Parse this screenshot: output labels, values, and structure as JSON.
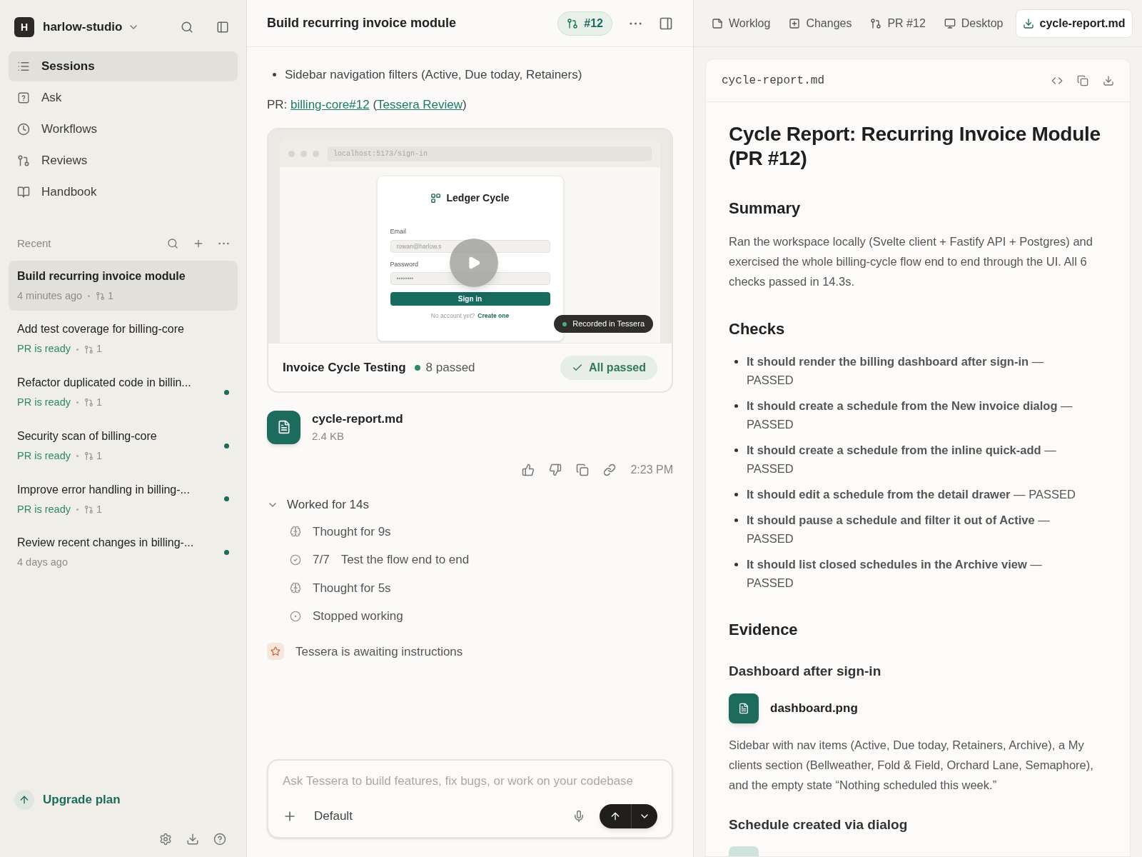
{
  "workspace": {
    "avatar": "H",
    "name": "harlow-studio"
  },
  "nav": [
    {
      "label": "Sessions",
      "selected": true
    },
    {
      "label": "Ask",
      "selected": false
    },
    {
      "label": "Workflows",
      "selected": false
    },
    {
      "label": "Reviews",
      "selected": false
    },
    {
      "label": "Handbook",
      "selected": false
    }
  ],
  "recent": {
    "title": "Recent",
    "sessions": [
      {
        "title": "Build recurring invoice module",
        "meta": "4 minutes ago",
        "kind": "time",
        "pr_count": "1",
        "unread": false,
        "selected": true
      },
      {
        "title": "Add test coverage for billing-core",
        "meta": "PR is ready",
        "kind": "ready",
        "pr_count": "1",
        "unread": false,
        "selected": false
      },
      {
        "title": "Refactor duplicated code in billin...",
        "meta": "PR is ready",
        "kind": "ready",
        "pr_count": "1",
        "unread": true,
        "selected": false
      },
      {
        "title": "Security scan of billing-core",
        "meta": "PR is ready",
        "kind": "ready",
        "pr_count": "1",
        "unread": true,
        "selected": false
      },
      {
        "title": "Improve error handling in billing-...",
        "meta": "PR is ready",
        "kind": "ready",
        "pr_count": "1",
        "unread": true,
        "selected": false
      },
      {
        "title": "Review recent changes in billing-...",
        "meta": "4 days ago",
        "kind": "time",
        "unread": true,
        "selected": false
      }
    ]
  },
  "upgrade": {
    "label": "Upgrade plan"
  },
  "chat": {
    "title": "Build recurring invoice module",
    "pr_badge": "#12",
    "bullet": "Sidebar navigation filters (Active, Due today, Retainers)",
    "pr_line": {
      "prefix": "PR:",
      "link": "billing-core#12",
      "open": "(",
      "review_link": "Tessera Review",
      "close": ")"
    },
    "recording": {
      "url": "localhost:5173/sign-in",
      "brand": "Ledger Cycle",
      "email_label": "Email",
      "email_value": "rowan@harlow.s",
      "password_label": "Password",
      "password_value": "••••••••",
      "button": "Sign in",
      "footer": "No account yet?",
      "footer_link": "Create one",
      "badge": "Recorded in Tessera",
      "title": "Invoice Cycle Testing",
      "passed": "8 passed",
      "status": "All passed"
    },
    "attachment": {
      "name": "cycle-report.md",
      "size": "2.4 KB"
    },
    "time": "2:23 PM",
    "worklog": {
      "title": "Worked for 14s",
      "expanded": true,
      "steps": [
        {
          "kind": "thought",
          "label": "Thought for 9s"
        },
        {
          "kind": "task",
          "count": "7/7",
          "label": "Test the flow end to end"
        },
        {
          "kind": "thought",
          "label": "Thought for 5s"
        },
        {
          "kind": "stopped",
          "label": "Stopped working"
        }
      ]
    },
    "status": "Tessera is awaiting instructions",
    "composer": {
      "placeholder": "Ask Tessera to build features, fix bugs, or work on your codebase",
      "mode": "Default"
    }
  },
  "tabs": [
    {
      "label": "Worklog",
      "selected": false
    },
    {
      "label": "Changes",
      "selected": false
    },
    {
      "label": "PR #12",
      "selected": false
    },
    {
      "label": "Desktop",
      "selected": false
    },
    {
      "label": "cycle-report.md",
      "selected": true
    }
  ],
  "document": {
    "filename": "cycle-report.md",
    "blocks": [
      {
        "kind": "h1",
        "text": "Cycle Report: Recurring Invoice Module (PR #12)"
      },
      {
        "kind": "h2",
        "text": "Summary"
      },
      {
        "kind": "p",
        "text": "Ran the workspace locally (Svelte client + Fastify API + Postgres) and exercised the whole billing-cycle flow end to end through the UI. All 6 checks passed in 14.3s."
      },
      {
        "kind": "h2",
        "text": "Checks"
      },
      {
        "kind": "list",
        "items": [
          "**It should render the billing dashboard after sign-in** — PASSED",
          "**It should create a schedule from the New invoice dialog** — PASSED",
          "**It should create a schedule from the inline quick-add** — PASSED",
          "**It should edit a schedule from the detail drawer** — PASSED",
          "**It should pause a schedule and filter it out of Active** — PASSED",
          "**It should list closed schedules in the Archive view** — PASSED"
        ]
      },
      {
        "kind": "h2",
        "text": "Evidence"
      },
      {
        "kind": "h3",
        "text": "Dashboard after sign-in"
      },
      {
        "kind": "file",
        "text": "dashboard.png"
      },
      {
        "kind": "p",
        "text": "Sidebar with nav items (Active, Due today, Retainers, Archive), a My clients section (Bellweather, Fold & Field, Orchard Lane, Semaphore), and the empty state “Nothing scheduled this week.”"
      },
      {
        "kind": "h3",
        "text": "Schedule created via dialog"
      },
      {
        "kind": "file_cut"
      }
    ]
  }
}
